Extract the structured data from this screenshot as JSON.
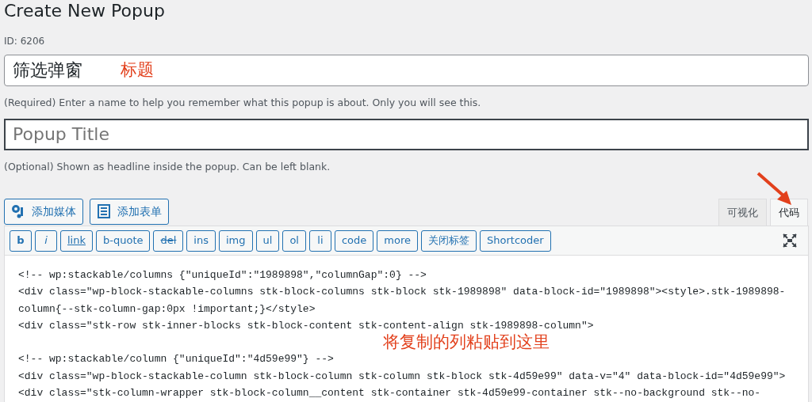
{
  "page": {
    "title": "Create New Popup",
    "id_label": "ID: 6206"
  },
  "title_field": {
    "value": "筛选弹窗",
    "annotation": "标题",
    "help": "(Required) Enter a name to help you remember what this popup is about. Only you will see this."
  },
  "popup_title_field": {
    "placeholder": "Popup Title",
    "help": "(Optional) Shown as headline inside the popup. Can be left blank."
  },
  "media_buttons": [
    {
      "label": "添加媒体",
      "kind": "media"
    },
    {
      "label": "添加表单",
      "kind": "form"
    }
  ],
  "editor_tabs": [
    {
      "label": "可视化",
      "selected": false
    },
    {
      "label": "代码",
      "selected": true
    }
  ],
  "quicktags": [
    {
      "label": "b",
      "kind": "bold"
    },
    {
      "label": "i",
      "kind": "italic"
    },
    {
      "label": "link",
      "kind": "link"
    },
    {
      "label": "b-quote",
      "kind": "plain"
    },
    {
      "label": "del",
      "kind": "strike"
    },
    {
      "label": "ins",
      "kind": "plain"
    },
    {
      "label": "img",
      "kind": "plain"
    },
    {
      "label": "ul",
      "kind": "plain"
    },
    {
      "label": "ol",
      "kind": "plain"
    },
    {
      "label": "li",
      "kind": "plain"
    },
    {
      "label": "code",
      "kind": "plain"
    },
    {
      "label": "more",
      "kind": "plain"
    },
    {
      "label": "关闭标签",
      "kind": "plain"
    },
    {
      "label": "Shortcoder",
      "kind": "plain"
    }
  ],
  "code_blocks": [
    [
      "<!-- wp:stackable/columns {\"uniqueId\":\"1989898\",\"columnGap\":0} -->",
      "<div class=\"wp-block-stackable-columns stk-block-columns stk-block stk-1989898\" data-block-id=\"1989898\"><style>.stk-1989898-",
      "column{--stk-column-gap:0px !important;}</style>",
      "<div class=\"stk-row stk-inner-blocks stk-block-content stk-content-align stk-1989898-column\">"
    ],
    [
      "<!-- wp:stackable/column {\"uniqueId\":\"4d59e99\"} -->",
      "<div class=\"wp-block-stackable-column stk-block-column stk-column stk-block stk-4d59e99\" data-v=\"4\" data-block-id=\"4d59e99\">",
      "<div class=\"stk-column-wrapper stk-block-column__content stk-container stk-4d59e99-container stk--no-background stk--no-"
    ]
  ],
  "code_annotation": "将复制的列粘贴到这里"
}
